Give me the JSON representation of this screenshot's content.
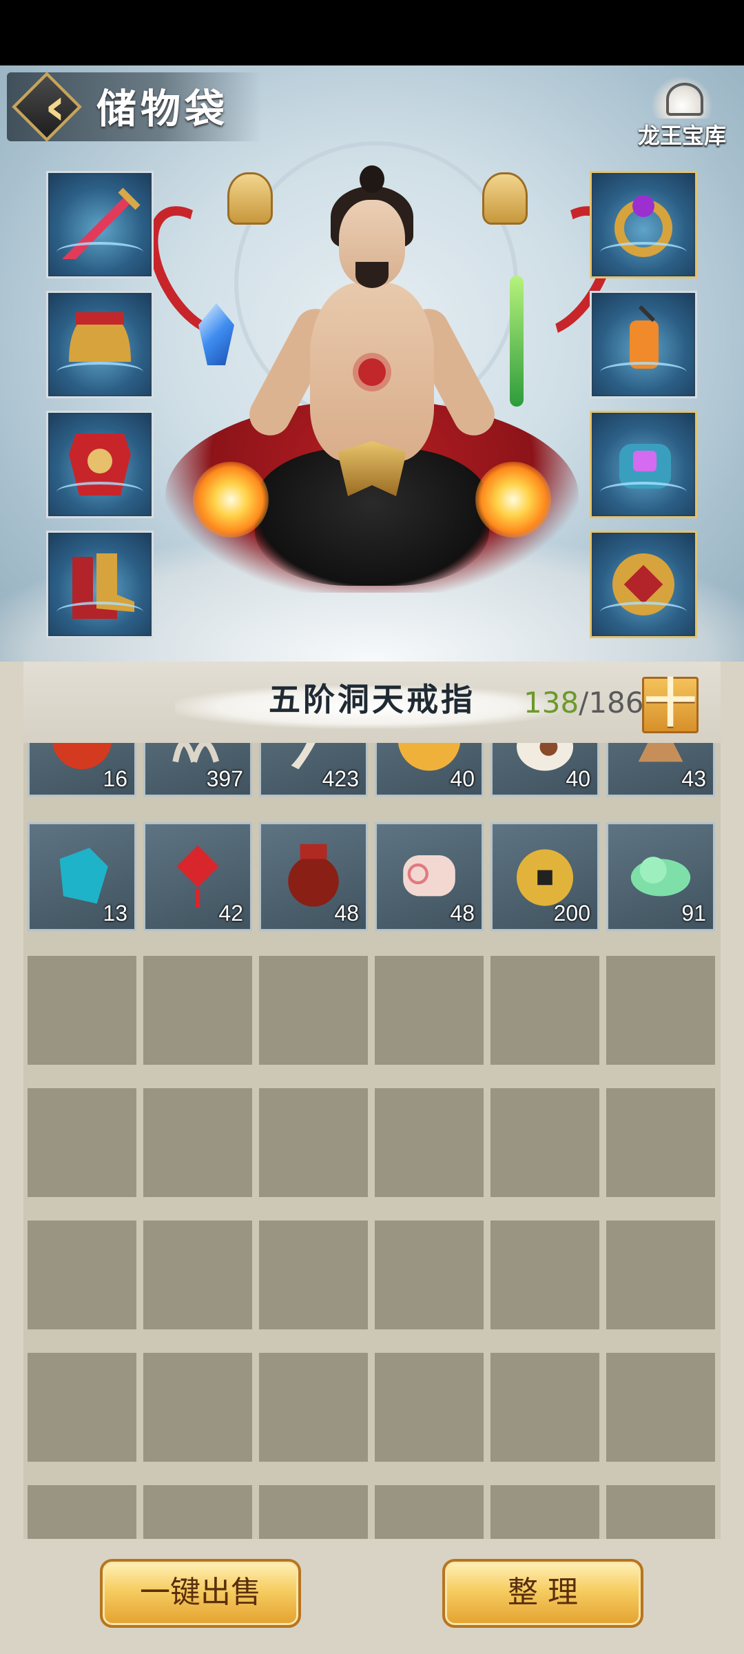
{
  "header": {
    "title": "储物袋",
    "treasury_label": "龙王宝库"
  },
  "equipment": {
    "left": [
      "sword-icon",
      "helmet-icon",
      "armor-icon",
      "boots-icon"
    ],
    "right": [
      "ring-icon",
      "lantern-icon",
      "bracelet-icon",
      "badge-icon"
    ]
  },
  "inventory": {
    "ring_name": "五阶洞天戒指",
    "capacity_used": "138",
    "capacity_total": "/186",
    "expand_label": "十",
    "partial_row": [
      {
        "icon": "red-orb-icon",
        "qty": "16"
      },
      {
        "icon": "claw-icon",
        "qty": "397"
      },
      {
        "icon": "fang-icon",
        "qty": "423"
      },
      {
        "icon": "golden-pill-icon",
        "qty": "40"
      },
      {
        "icon": "money-bag-icon",
        "qty": "40"
      },
      {
        "icon": "wooden-item-icon",
        "qty": "43"
      }
    ],
    "full_row": [
      {
        "icon": "blue-crystal-icon",
        "qty": "13"
      },
      {
        "icon": "chinese-knot-icon",
        "qty": "42"
      },
      {
        "icon": "wine-jar-icon",
        "qty": "48"
      },
      {
        "icon": "swirl-cake-icon",
        "qty": "48"
      },
      {
        "icon": "copper-coin-icon",
        "qty": "200"
      },
      {
        "icon": "green-cloud-icon",
        "qty": "91"
      }
    ]
  },
  "buttons": {
    "sell_all": "一键出售",
    "arrange": "整 理"
  },
  "colors": {
    "capacity_used": "#6b9a2c",
    "button_gold": "#f6cd61"
  }
}
